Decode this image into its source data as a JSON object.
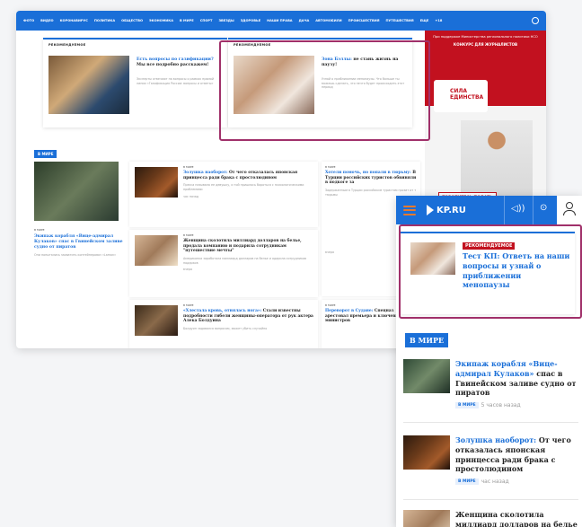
{
  "desktop": {
    "nav": [
      "ФОТО",
      "ВИДЕО",
      "КОРОНАВИРУС",
      "ПОЛИТИКА",
      "ОБЩЕСТВО",
      "ЭКОНОМИКА",
      "В МИРЕ",
      "СПОРТ",
      "ЗВЕЗДЫ",
      "ЗДОРОВЬЕ",
      "НАШИ ПРАВА",
      "ДАЧА",
      "АВТОМОБИЛИ",
      "ПРОИСШЕСТВИЯ",
      "ПУТЕШЕСТВИЯ",
      "ЕЩЕ"
    ],
    "nav_extra": "+18",
    "rec1": {
      "tag": "РЕКОМЕНДУЕМОЕ",
      "title_blue": "Есть вопросы по газификации?",
      "title_rest": " Мы все подробно расскажем!",
      "sub": "Эксперты отвечают на вопросы о рамках прямой линии «Газификация России: вопросы и ответы»"
    },
    "rec2": {
      "tag": "РЕКОМЕНДУЕМОЕ",
      "title_blue": "Зона Бэллы:",
      "title_rest": " не стань жизнь на паузу!",
      "sub": "Узнай о приближении менопаузы. Что больше ты можешь сделать, что нечто будет происходить этот период"
    },
    "ad": {
      "top": "При поддержке Министерства регионального политики НСО",
      "contest": "КОНКУРС ДЛЯ ЖУРНАЛИСТОВ",
      "logo": "СИЛА ЕДИНСТВА",
      "cta": "ТОРОПИТЕСЬ ПОДАТЬ ЗАЯВКУ"
    },
    "section": "В МИРЕ",
    "left": {
      "tag": "В МИРЕ",
      "title": "Экипаж корабля «Вице-адмирал Кулаков» спас в Гвинейском заливе судно от пиратов",
      "sub": "Они попытались захватить контейнеровоз «Laman»"
    },
    "mid": [
      {
        "tag": "В МИРЕ",
        "blue": "Золушка наоборот:",
        "rest": " От чего отказалась японская принцесса ради брака с простолюдином",
        "sub": "Пресса называла ее девушку, и той пришлось бороться с психологическими проблемами",
        "time": "час назад"
      },
      {
        "tag": "В МИРЕ",
        "blue": "",
        "rest": "Женщина сколотила миллиард долларов на белье, продала компанию и подарила сотрудникам \"путешествие мечты\"",
        "sub": "Американка заработала миллиард долларов на белье и одарила сотрудников подарков",
        "time": "вчера"
      },
      {
        "tag": "В МИРЕ",
        "blue": "«Хлестала кровь, отнялась нога»:",
        "rest": " Стали известны подробности гибели женщины-оператора от рук актера Алека Болдуина",
        "sub": "Болдуин задавался вопросом, может убить случайно",
        "time": ""
      }
    ],
    "right": [
      {
        "tag": "В МИРЕ",
        "blue": "Хотели помочь, но попали в тюрьму:",
        "rest": " В Турции российских туристов обвиняли в подкоге за",
        "sub": "Задержанным в Турции российским туристам грозит от т тюрьмы",
        "time": "вчера"
      },
      {
        "tag": "В МИРЕ",
        "blue": "Переворот в Судане:",
        "rest": " Спецназ арестовал премьера и ключевых министров",
        "sub": "",
        "time": ""
      }
    ]
  },
  "mobile": {
    "logo": "KP.RU",
    "rec": {
      "tag": "РЕКОМЕНДУЕМОЕ",
      "title": "Тест КП: Ответь на наши вопросы и узнай о приближении менопаузы"
    },
    "section": "В МИРЕ",
    "items": [
      {
        "blue": "Экипаж корабля «Вице-адмирал Кулаков»",
        "rest": " спас в Гвинейском заливе судно от пиратов",
        "tag": "В МИРЕ",
        "time": "5 часов назад"
      },
      {
        "blue": "Золушка наоборот:",
        "rest": " От чего отказалась японская принцесса ради брака с простолюдином",
        "tag": "В МИРЕ",
        "time": "час назад"
      },
      {
        "blue": "",
        "rest": "Женщина сколотила миллиард долларов на белье",
        "tag": "",
        "time": ""
      }
    ]
  },
  "colors": {
    "brand": "#1a6fd8",
    "highlight": "#a0306a",
    "ad_red": "#c2111f"
  }
}
